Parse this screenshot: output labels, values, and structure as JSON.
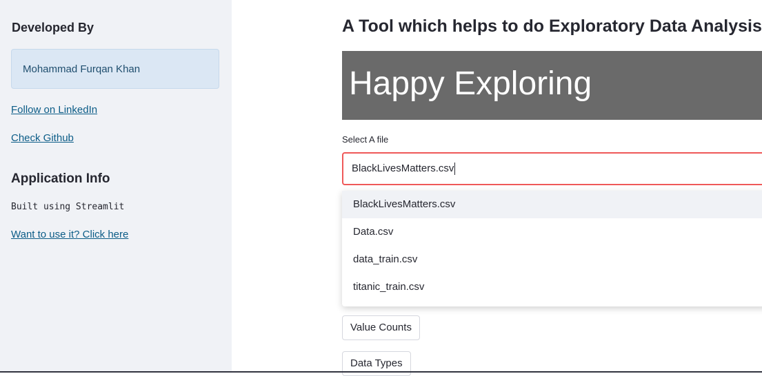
{
  "sidebar": {
    "developed_by_heading": "Developed By",
    "developer_name": "Mohammad Furqan Khan",
    "linkedin_link": "Follow on LinkedIn",
    "github_link": "Check Github",
    "app_info_heading": "Application Info",
    "built_with": "Built using Streamlit",
    "use_it_link": "Want to use it? Click here"
  },
  "main": {
    "title": "A Tool which helps to do Exploratory Data Analysis.",
    "banner_text": "Happy Exploring",
    "file_select": {
      "label": "Select A file",
      "value": "BlackLivesMatters.csv",
      "options": [
        "BlackLivesMatters.csv",
        "Data.csv",
        "data_train.csv",
        "titanic_train.csv"
      ],
      "highlighted_index": 0
    },
    "buttons": {
      "value_counts": "Value Counts",
      "data_types": "Data Types"
    }
  },
  "colors": {
    "sidebar_bg": "#f0f2f6",
    "info_box_bg": "#dbe7f4",
    "banner_bg": "#6a6a6a",
    "focus_border": "#ef5858",
    "link": "#0b5c87"
  }
}
